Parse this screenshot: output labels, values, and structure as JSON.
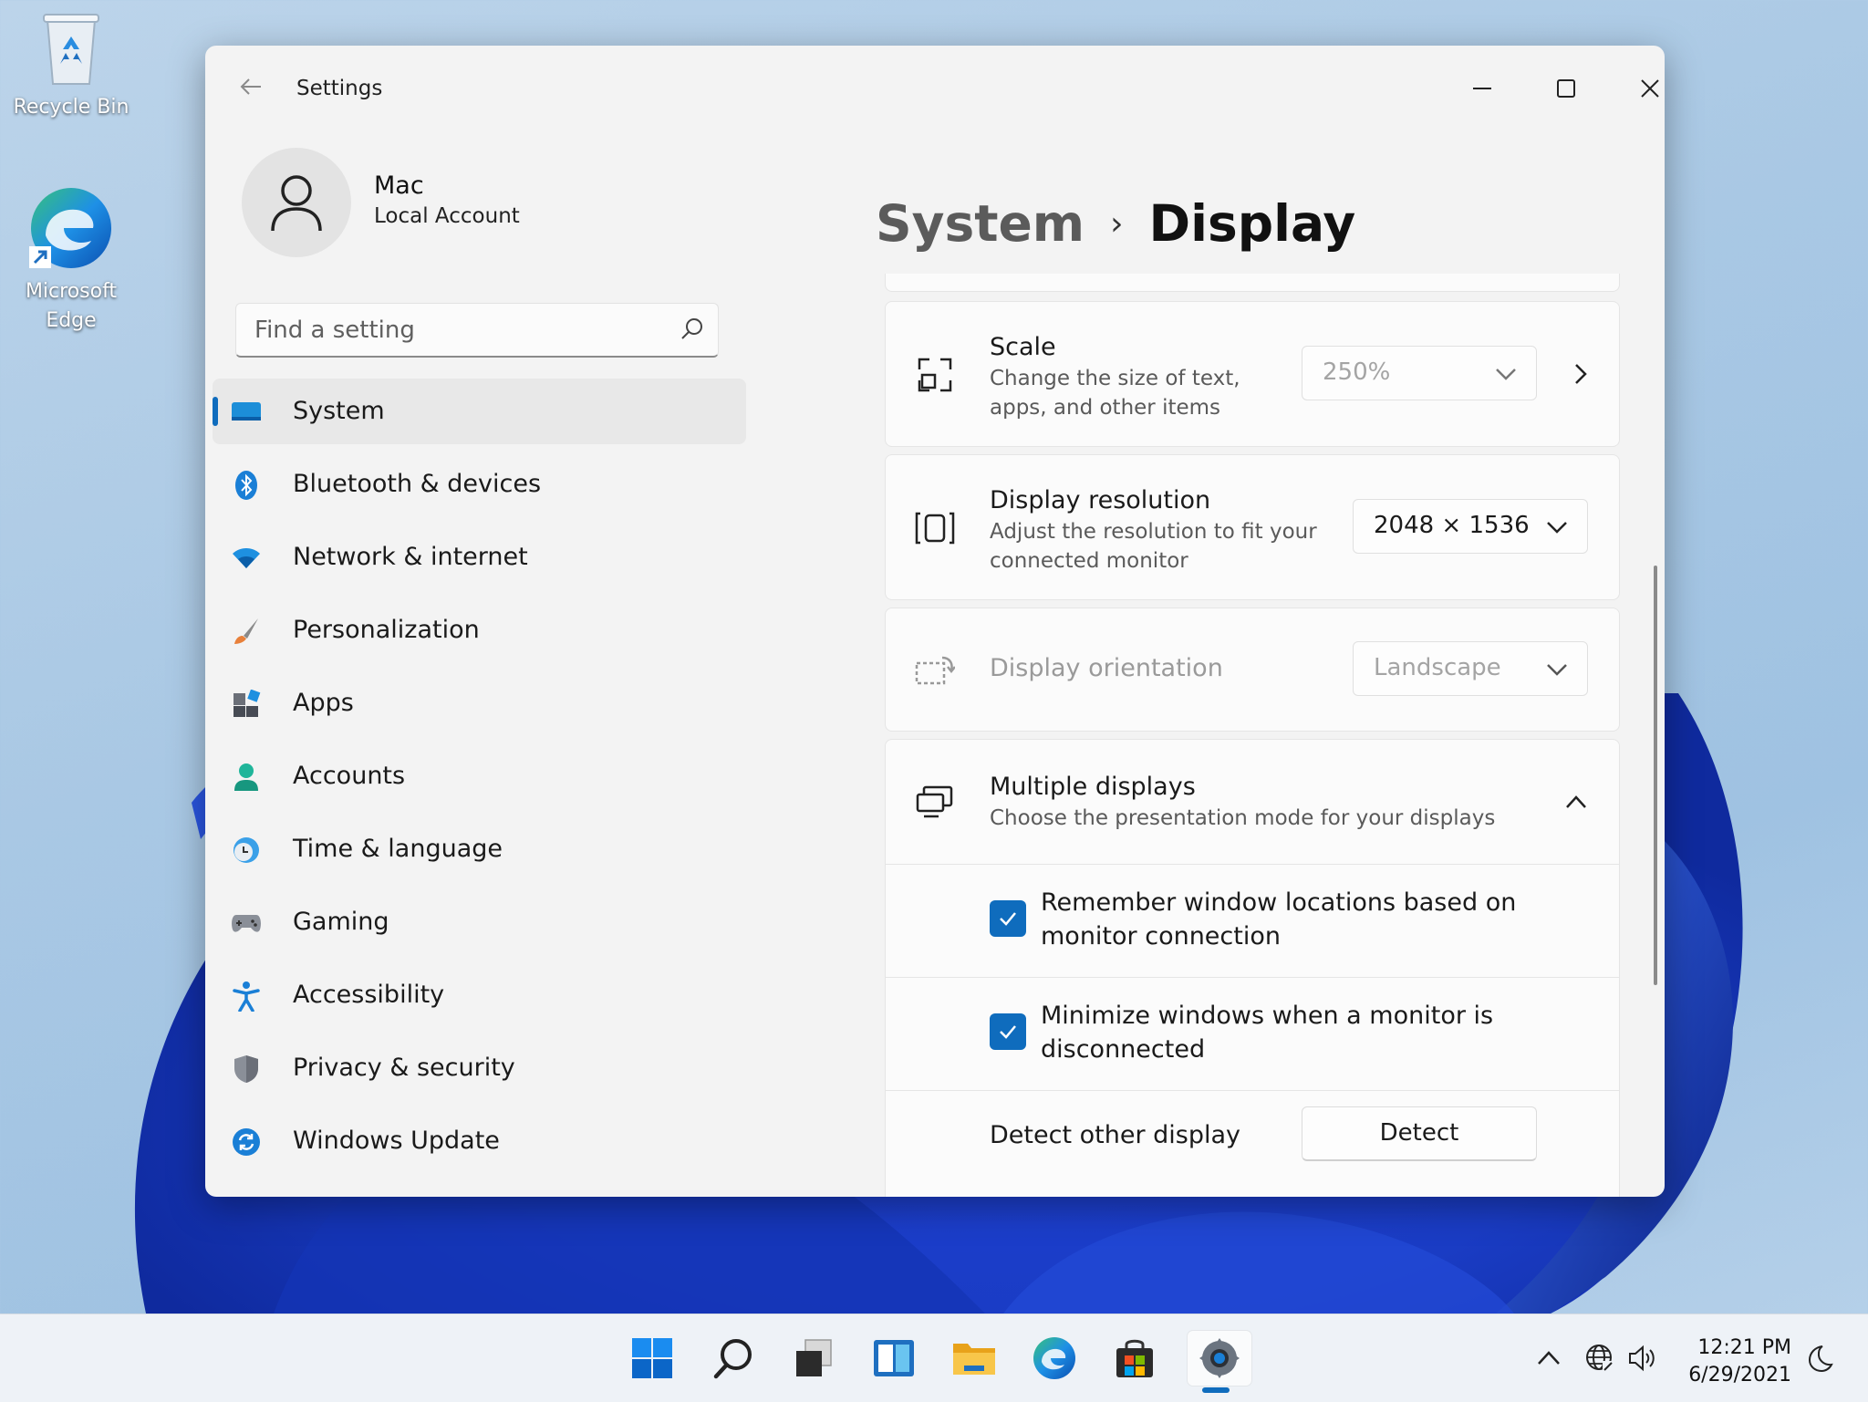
{
  "desktop": {
    "icons": [
      {
        "label": "Recycle Bin",
        "icon": "recycle-bin-icon"
      },
      {
        "label": "Microsoft Edge",
        "icon": "edge-icon"
      }
    ]
  },
  "window": {
    "title": "Settings",
    "back_icon": "back-arrow-icon",
    "controls": [
      "minimize",
      "maximize",
      "close"
    ]
  },
  "profile": {
    "name": "Mac",
    "account_type": "Local Account"
  },
  "search": {
    "placeholder": "Find a setting",
    "value": ""
  },
  "nav": {
    "items": [
      {
        "label": "System",
        "icon": "system-icon",
        "active": true
      },
      {
        "label": "Bluetooth & devices",
        "icon": "bluetooth-icon"
      },
      {
        "label": "Network & internet",
        "icon": "wifi-icon"
      },
      {
        "label": "Personalization",
        "icon": "brush-icon"
      },
      {
        "label": "Apps",
        "icon": "apps-icon"
      },
      {
        "label": "Accounts",
        "icon": "person-icon"
      },
      {
        "label": "Time & language",
        "icon": "clock-globe-icon"
      },
      {
        "label": "Gaming",
        "icon": "gamepad-icon"
      },
      {
        "label": "Accessibility",
        "icon": "accessibility-icon"
      },
      {
        "label": "Privacy & security",
        "icon": "shield-icon"
      },
      {
        "label": "Windows Update",
        "icon": "update-icon"
      }
    ]
  },
  "breadcrumb": {
    "parent": "System",
    "separator": "›",
    "current": "Display"
  },
  "settings": {
    "scale": {
      "title": "Scale",
      "description": "Change the size of text, apps, and other items",
      "value": "250%",
      "disabled": true
    },
    "resolution": {
      "title": "Display resolution",
      "description": "Adjust the resolution to fit your connected monitor",
      "value": "2048 × 1536"
    },
    "orientation": {
      "title": "Display orientation",
      "value": "Landscape",
      "disabled": true
    },
    "multiple_displays": {
      "title": "Multiple displays",
      "description": "Choose the presentation mode for your displays",
      "expanded": true,
      "options": [
        {
          "label": "Remember window locations based on monitor connection",
          "checked": true
        },
        {
          "label": "Minimize windows when a monitor is disconnected",
          "checked": true
        }
      ],
      "detect_label": "Detect other display",
      "detect_button": "Detect"
    }
  },
  "taskbar": {
    "apps": [
      "start-icon",
      "search-icon",
      "task-view-icon",
      "widgets-icon",
      "file-explorer-icon",
      "edge-icon",
      "store-icon",
      "settings-icon"
    ],
    "active_app": "settings-icon",
    "tray": [
      "chevron-up-icon",
      "network-globe-icon",
      "volume-icon"
    ],
    "time": "12:21 PM",
    "date": "6/29/2021",
    "notification_icon": "moon-icon"
  },
  "colors": {
    "accent": "#0f6cbd",
    "window_bg": "#f3f3f3",
    "card_bg": "#fbfbfb"
  }
}
